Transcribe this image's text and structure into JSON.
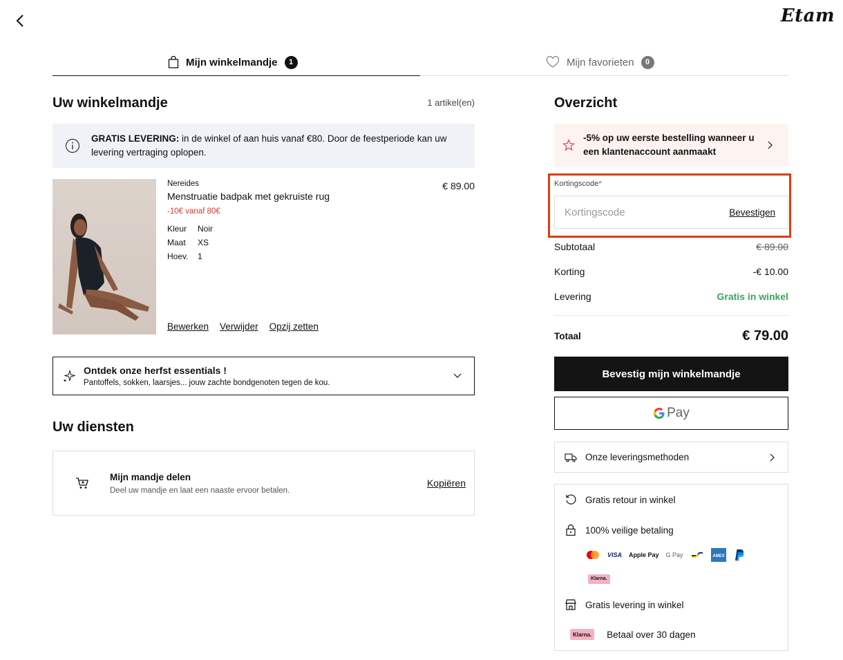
{
  "header": {
    "brand": "Etam"
  },
  "tabs": [
    {
      "label": "Mijn winkelmandje",
      "count": "1"
    },
    {
      "label": "Mijn favorieten",
      "count": "0"
    }
  ],
  "cart": {
    "title": "Uw winkelmandje",
    "count_text": "1 artikel(en)",
    "info_bold": "GRATIS LEVERING:",
    "info_text": " in de winkel of aan huis vanaf €80. Door de feestperiode kan uw levering vertraging oplopen.",
    "item": {
      "brand": "Nereides",
      "name": "Menstruatie badpak met gekruiste rug",
      "promo": "-10€ vanaf 80€",
      "price": "€ 89.00",
      "attributes": [
        {
          "key": "Kleur",
          "value": "Noir"
        },
        {
          "key": "Maat",
          "value": "XS"
        },
        {
          "key": "Hoev.",
          "value": "1"
        }
      ],
      "actions": [
        "Bewerken",
        "Verwijder",
        "Opzij zetten"
      ]
    },
    "essentials": {
      "title": "Ontdek onze herfst essentials !",
      "subtitle": "Pantoffels, sokken, laarsjes... jouw zachte bondgenoten tegen de kou."
    }
  },
  "services": {
    "title": "Uw diensten",
    "share_title": "Mijn mandje delen",
    "share_sub": "Deel uw mandje en laat een naaste ervoor betalen.",
    "share_action": "Kopiëren"
  },
  "overview": {
    "title": "Overzicht",
    "promo": "-5% op uw eerste bestelling wanneer u een klantenaccount aanmaakt",
    "code_label": "Kortingscode",
    "code_required": "*",
    "code_placeholder": "Kortingscode",
    "code_action": "Bevestigen",
    "subtotal_label": "Subtotaal",
    "subtotal_value": "€ 89.00",
    "discount_label": "Korting",
    "discount_value": "-€ 10.00",
    "delivery_label": "Levering",
    "delivery_value": "Gratis in winkel",
    "total_label": "Totaal",
    "total_value": "€ 79.00",
    "confirm_button": "Bevestig mijn winkelmandje",
    "gpay_label": "Pay",
    "delivery_methods": "Onze leveringsmethoden",
    "assurances": {
      "returns": "Gratis retour in winkel",
      "secure": "100% veilige betaling",
      "free_delivery": "Gratis levering in winkel",
      "pay_later": "Betaal over 30 dagen"
    },
    "payment_logos": [
      "mastercard",
      "VISA",
      "Apple Pay",
      "G Pay",
      "bancontact",
      "AMEX",
      "PayPal",
      "Klarna."
    ],
    "klarna_text": "Klarna."
  },
  "colors": {
    "accent_highlight": "#e03b0e",
    "promo_red": "#d93a2b",
    "success_green": "#3da45a",
    "primary_button": "#141414"
  }
}
